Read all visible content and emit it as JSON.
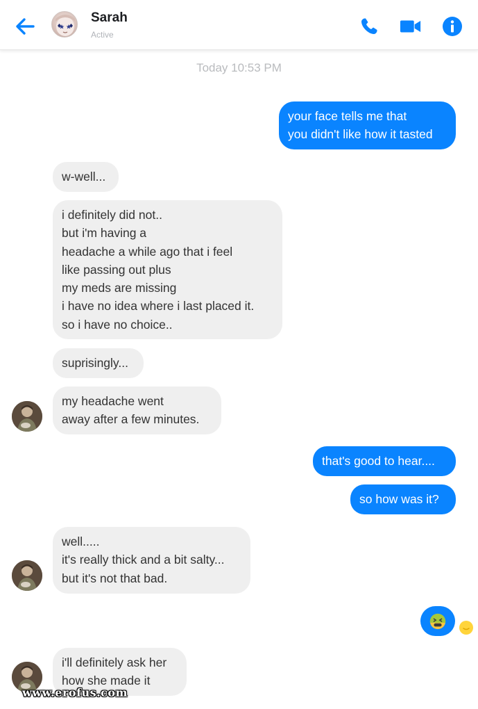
{
  "header": {
    "name": "Sarah",
    "status": "Active",
    "icons": [
      "back-arrow-icon",
      "phone-icon",
      "video-camera-icon",
      "info-icon"
    ],
    "accent_color": "#0a84ff"
  },
  "timestamp": "Today 10:53 PM",
  "messages": [
    {
      "from": "me",
      "text": "your face tells me that\nyou didn't like how it tasted"
    },
    {
      "from": "sarah",
      "text": "w-well..."
    },
    {
      "from": "sarah",
      "text": "i definitely did not..\nbut i'm having a\nheadache a while ago that i feel\nlike passing out plus\nmy meds are missing\ni have no idea where i last placed it.\nso i have no choice.."
    },
    {
      "from": "sarah",
      "text": "suprisingly..."
    },
    {
      "from": "sarah",
      "text": "my headache went\naway after a few minutes."
    },
    {
      "from": "me",
      "text": "that's good to hear...."
    },
    {
      "from": "me",
      "text": "so how was it?"
    },
    {
      "from": "sarah",
      "text": "well.....\nit's really thick and a bit salty...\nbut it's not that bad."
    },
    {
      "from": "me",
      "emoji": "nauseated-face-emoji"
    },
    {
      "from": "sarah",
      "text": "i'll definitely ask her\nhow she made it"
    }
  ],
  "seen_indicator": "seen-emoji-icon",
  "watermark": "www.erofus.com"
}
